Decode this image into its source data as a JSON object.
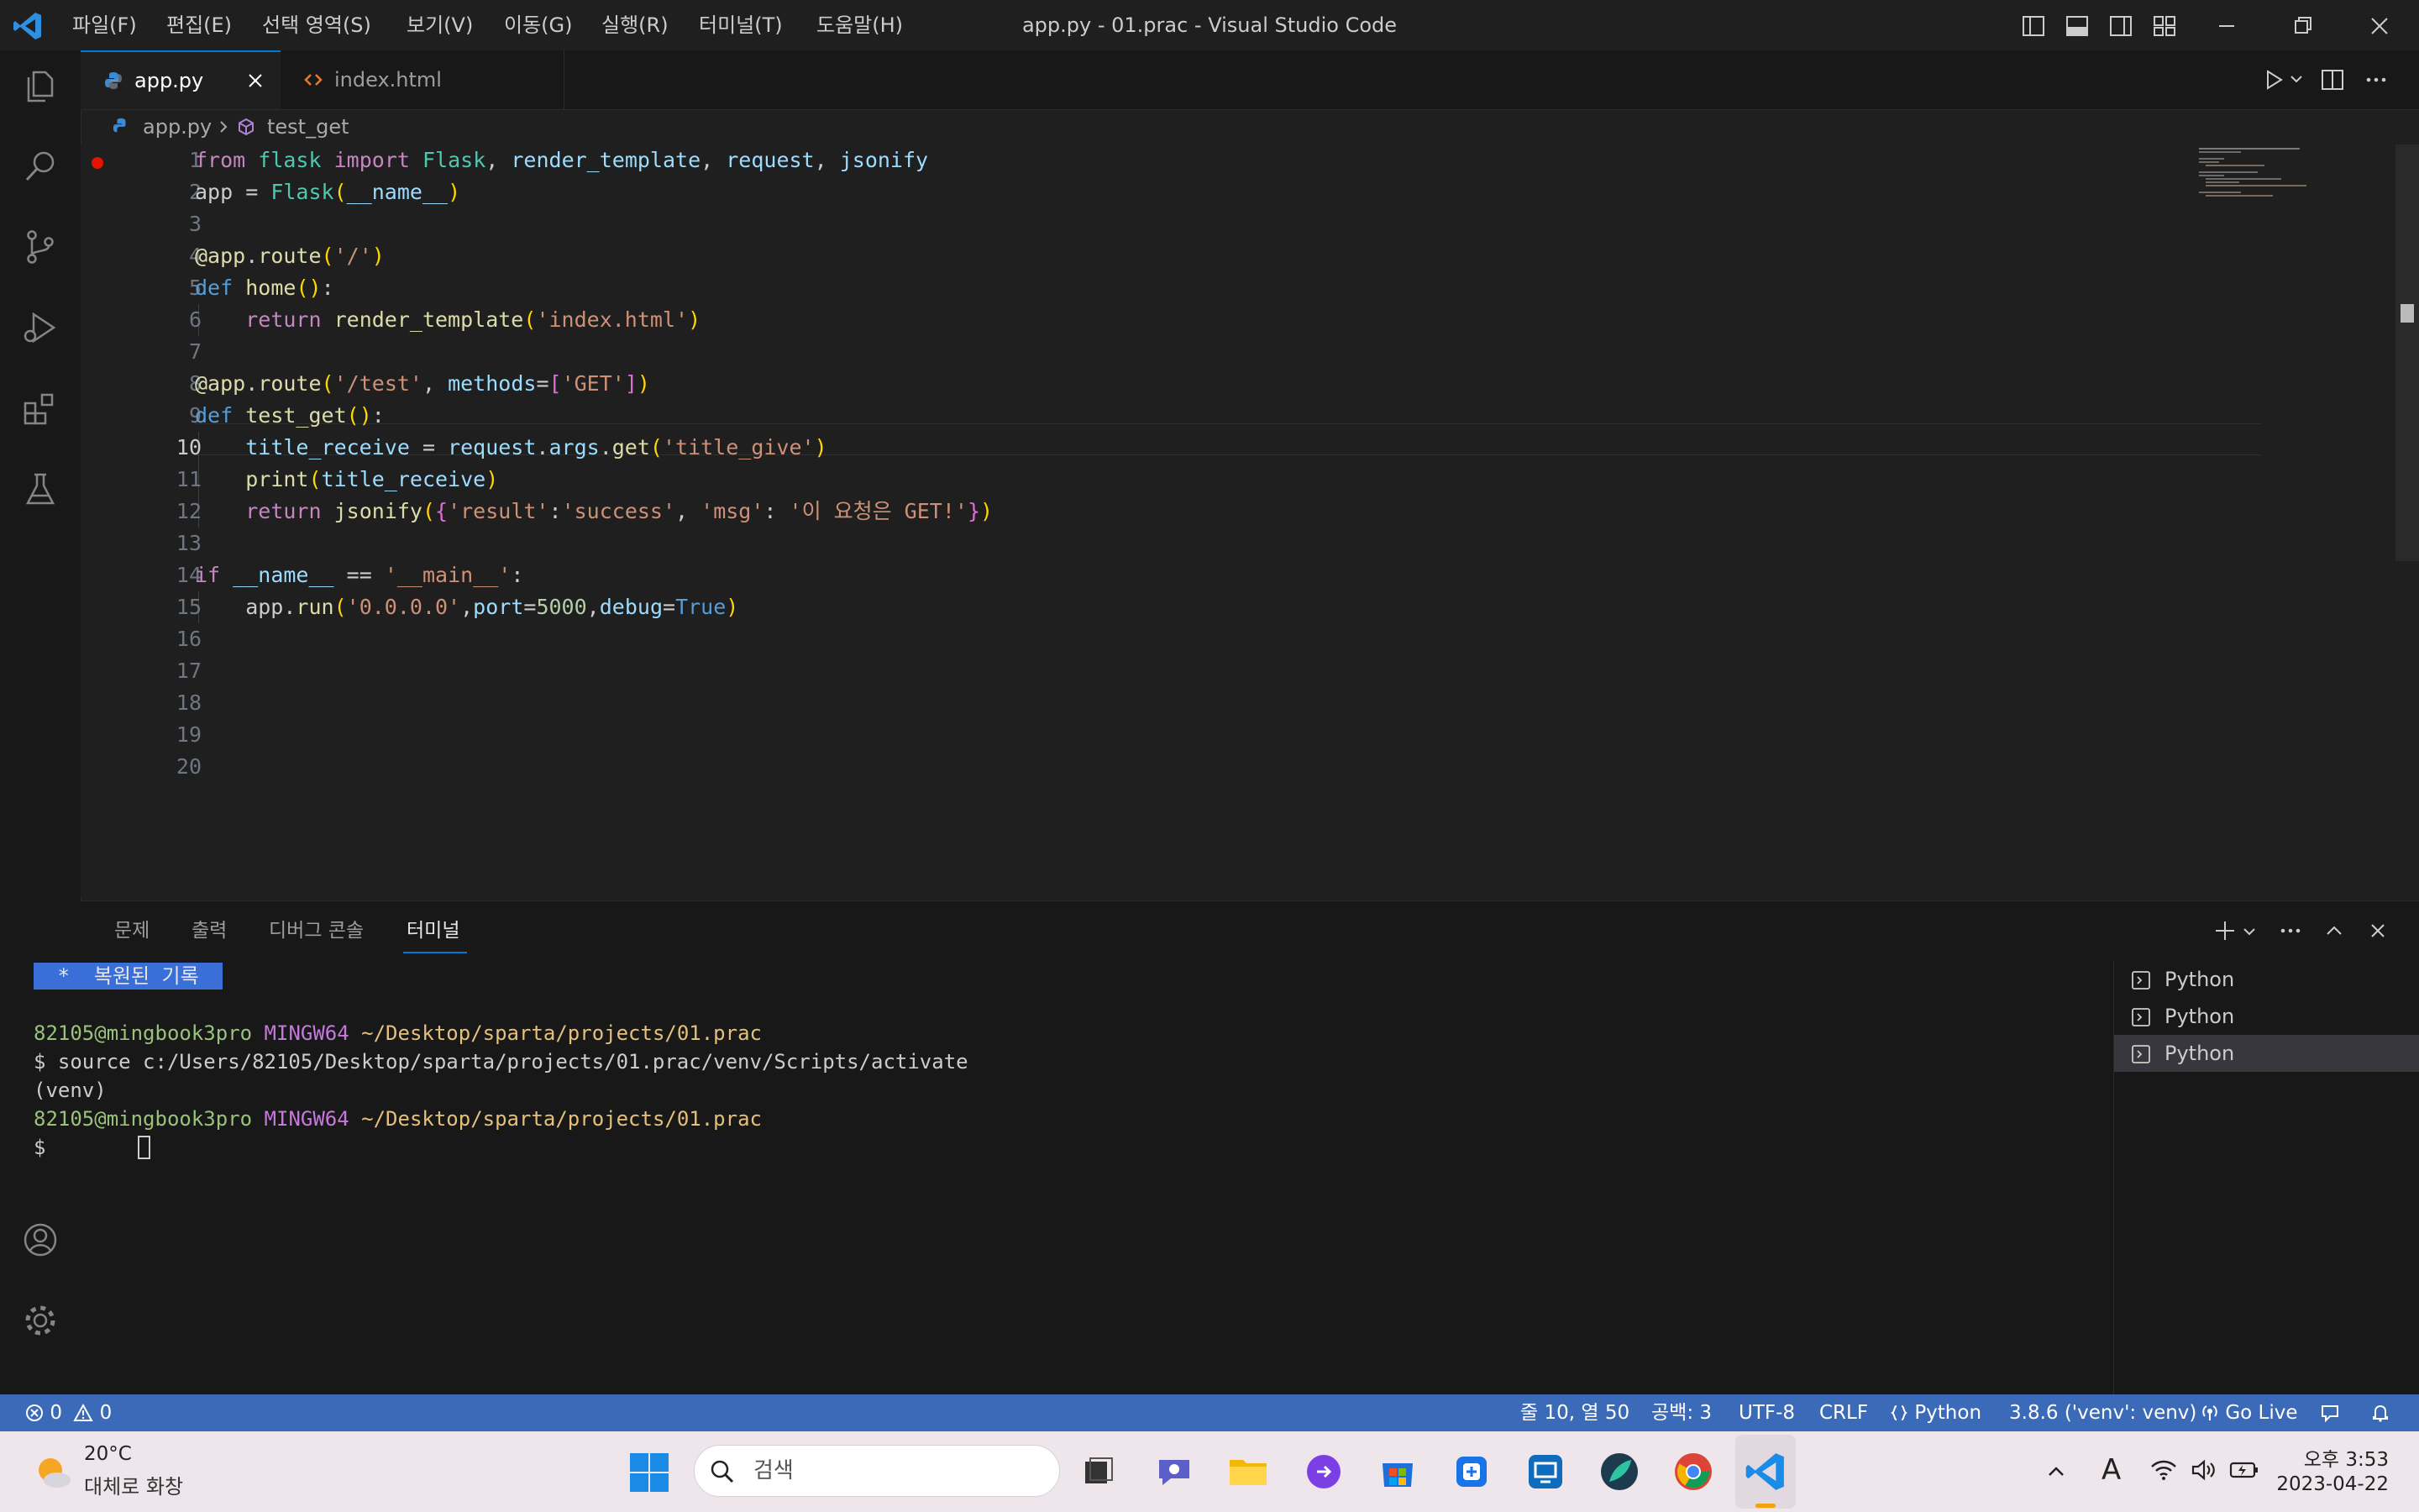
{
  "titlebar": {
    "menus": [
      "파일(F)",
      "편집(E)",
      "선택 영역(S)",
      "보기(V)",
      "이동(G)",
      "실행(R)",
      "터미널(T)",
      "도움말(H)"
    ],
    "title": "app.py - 01.prac - Visual Studio Code"
  },
  "tabs": [
    {
      "label": "app.py",
      "active": true
    },
    {
      "label": "index.html",
      "active": false
    }
  ],
  "breadcrumb": {
    "file": "app.py",
    "symbol": "test_get"
  },
  "editor": {
    "active_line": 10,
    "line_numbers": [
      "1",
      "2",
      "3",
      "4",
      "5",
      "6",
      "7",
      "8",
      "9",
      "10",
      "11",
      "12",
      "13",
      "14",
      "15",
      "16",
      "17",
      "18",
      "19",
      "20"
    ],
    "lines": [
      "from flask import Flask, render_template, request, jsonify",
      "app = Flask(__name__)",
      "",
      "@app.route('/')",
      "def home():",
      "    return render_template('index.html')",
      "",
      "@app.route('/test', methods=['GET'])",
      "def test_get():",
      "    title_receive = request.args.get('title_give')",
      "    print(title_receive)",
      "    return jsonify({'result':'success', 'msg': '이 요청은 GET!'})",
      "",
      "if __name__ == '__main__':",
      "    app.run('0.0.0.0',port=5000,debug=True)",
      "",
      "",
      "",
      "",
      ""
    ]
  },
  "panel": {
    "tabs": [
      "문제",
      "출력",
      "디버그 콘솔",
      "터미널"
    ],
    "active_tab": "터미널",
    "restored_banner": " *  복원된 기록 ",
    "prompt_user": "82105@mingbook3pro",
    "prompt_env": "MINGW64",
    "prompt_path": "~/Desktop/sparta/projects/01.prac",
    "command": "$ source c:/Users/82105/Desktop/sparta/projects/01.prac/venv/Scripts/activate",
    "venv_line": "(venv)",
    "prompt_symbol": "$ ",
    "terminals": [
      "Python",
      "Python",
      "Python"
    ],
    "selected_terminal": 2
  },
  "statusbar": {
    "errors": "0",
    "warnings": "0",
    "position": "줄 10, 열 50",
    "spaces": "공백: 3",
    "encoding": "UTF-8",
    "eol": "CRLF",
    "language": "Python",
    "interpreter": "3.8.6 ('venv': venv)",
    "go_live": "Go Live",
    "accent_color": "#3a6ab8"
  },
  "taskbar": {
    "weather_temp": "20°C",
    "weather_desc": "대체로 화창",
    "search_placeholder": "검색",
    "time": "오후 3:53",
    "date": "2023-04-22",
    "ime": "A"
  }
}
